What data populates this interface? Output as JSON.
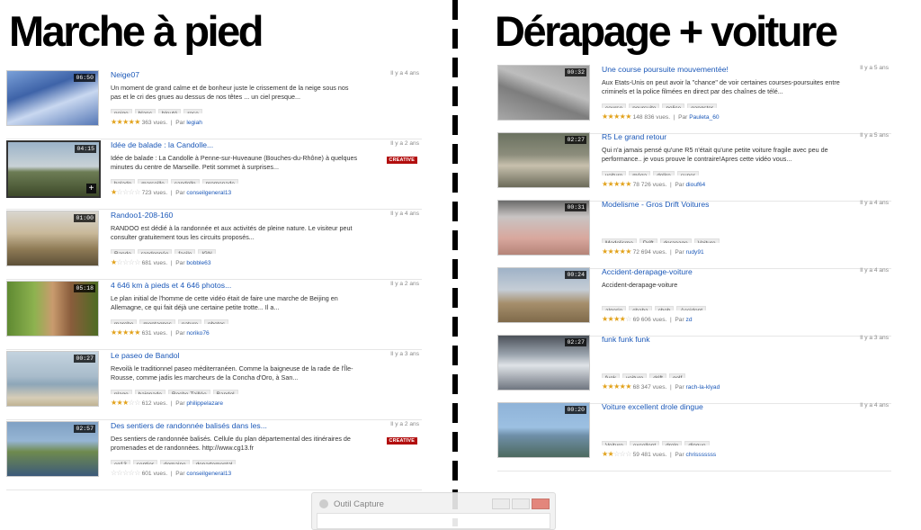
{
  "headings": {
    "left": "Marche à pied",
    "right": "Dérapage + voiture"
  },
  "colors": {
    "link": "#1b58b8",
    "star": "#e2a21b",
    "creative_badge": "#b20e0e"
  },
  "by_prefix": "Par",
  "views_suffix": "vues",
  "left_results": [
    {
      "title": "Neige07",
      "duration": "06:50",
      "age": "Il y a 4 ans",
      "description": "Un moment de grand calme et de bonheur juste le crissement de la neige sous nos pas et le cri des grues au dessus de nos têtes ... un ciel presque...",
      "tags": [
        "neige",
        "blanc",
        "bleuté",
        "rose"
      ],
      "rating": 5,
      "views": "363",
      "author": "legiah",
      "creative": false,
      "selected": false,
      "thumb_icon": "snow-scene-thumbnail"
    },
    {
      "title": "Idée de balade : la Candolle...",
      "duration": "04:15",
      "age": "Il y a 2 ans",
      "description": "Idée de balade : La Candolle à Penne-sur-Huveaune (Bouches-du-Rhône) à quelques minutes du centre de Marseille. Petit sommet à surprises...",
      "tags": [
        "balade",
        "marseille",
        "candolle",
        "promenade"
      ],
      "rating": 1,
      "views": "723",
      "author": "conseilgeneral13",
      "creative": true,
      "creative_label": "CREATIVE",
      "selected": true,
      "thumb_icon": "hillside-thumbnail"
    },
    {
      "title": "Randoo1-208-160",
      "duration": "01:00",
      "age": "Il y a 4 ans",
      "description": "RANDOO est dédié à la randonnée et aux activités de pleine nature. Le visiteur peut consulter gratuitement tous les circuits proposés...",
      "tags": [
        "Rando",
        "randonnée",
        "facile",
        "IGN"
      ],
      "rating": 1,
      "views": "681",
      "author": "bobble63",
      "creative": false,
      "selected": false,
      "thumb_icon": "hiker-thumbnail"
    },
    {
      "title": "4 646 km à pieds et 4 646 photos...",
      "duration": "05:18",
      "age": "Il y a 2 ans",
      "description": "Le plan initial de l'homme de cette vidéo était de faire une marche de Beijing en Allemagne, ce qui fait déjà une certaine petite trotte... Il a...",
      "tags": [
        "marche",
        "montagnes",
        "nature",
        "photos"
      ],
      "rating": 5,
      "views": "631",
      "author": "noriko76",
      "creative": false,
      "selected": false,
      "thumb_icon": "bearded-man-thumbnail"
    },
    {
      "title": "Le paseo de Bandol",
      "duration": "00:27",
      "age": "Il y a 3 ans",
      "description": "Revoilà le traditionnel paseo méditerranéen. Comme la baigneuse de la rade de l'Île-Rousse, comme jadis les marcheurs de la Concha d'Oro, à San...",
      "tags": [
        "plage",
        "baignade",
        "Roche-Taillée",
        "Bandol"
      ],
      "rating": 3,
      "views": "612",
      "author": "philippelazare",
      "creative": false,
      "selected": false,
      "thumb_icon": "beach-thumbnail"
    },
    {
      "title": "Des sentiers de randonnée balisés dans les...",
      "duration": "02:57",
      "age": "Il y a 2 ans",
      "description": "Des sentiers de randonnée balisés. Cellule du plan départemental des itinéraires de promenades et de randonnées. http://www.cg13.fr",
      "tags": [
        "cg13",
        "sentier",
        "domaine",
        "departemental"
      ],
      "rating": 0,
      "views": "601",
      "author": "conseilgeneral13",
      "creative": true,
      "creative_label": "CREATIVE",
      "selected": false,
      "thumb_icon": "man-interview-thumbnail"
    }
  ],
  "right_results": [
    {
      "title": "Une course poursuite mouvementée!",
      "duration": "00:32",
      "age": "Il y a 5 ans",
      "description": "Aux Etats-Unis on peut avoir la \"chance\" de voir certaines courses-poursuites entre criminels et la police filmées en direct par des chaînes de télé...",
      "tags": [
        "course",
        "poursuite",
        "police",
        "gangster"
      ],
      "rating": 5,
      "views": "148 836",
      "author": "Pauleta_60",
      "creative": false,
      "selected": false,
      "thumb_icon": "highway-thumbnail"
    },
    {
      "title": "R5 Le grand retour",
      "duration": "02:27",
      "age": "Il y a 5 ans",
      "description": "Qui n'a jamais pensé qu'une R5 n'était qu'une petite voiture fragile avec peu de performance.. je vous prouve le contraire!Apres cette vidéo vous...",
      "tags": [
        "voiture",
        "méga",
        "delire",
        "super"
      ],
      "rating": 5,
      "views": "78 726",
      "author": "diouf64",
      "creative": false,
      "selected": false,
      "thumb_icon": "forest-track-thumbnail"
    },
    {
      "title": "Modelisme - Gros Drift Voitures",
      "duration": "00:31",
      "age": "Il y a 4 ans",
      "description": "",
      "tags": [
        "Modelisme",
        "Drift",
        "derapage",
        "Voiture"
      ],
      "rating": 5,
      "views": "72 694",
      "author": "rudy91",
      "creative": false,
      "selected": false,
      "thumb_icon": "rc-car-thumbnail"
    },
    {
      "title": "Accident-derapage-voiture",
      "duration": "00:24",
      "age": "Il y a 4 ans",
      "description": "Accident-derapage-voiture",
      "tags": [
        "algerie",
        "chaba",
        "cheb",
        "Accident"
      ],
      "rating": 4,
      "views": "69 606",
      "author": "zd",
      "creative": false,
      "selected": false,
      "thumb_icon": "crash-thumbnail"
    },
    {
      "title": "funk funk funk",
      "duration": "02:27",
      "age": "Il y a 3 ans",
      "description": "",
      "tags": [
        "funk",
        "voiture",
        "drift",
        "golf"
      ],
      "rating": 5,
      "views": "68 347",
      "author": "rach-la-klyad",
      "creative": false,
      "selected": false,
      "thumb_icon": "smoke-drift-thumbnail"
    },
    {
      "title": "Voiture excellent drole dingue",
      "duration": "00:20",
      "age": "Il y a 4 ans",
      "description": "",
      "tags": [
        "Voiture",
        "excellent",
        "drole",
        "dingue"
      ],
      "rating": 2,
      "views": "59 481",
      "author": "chrisssssss",
      "creative": false,
      "selected": false,
      "thumb_icon": "lake-thumbnail"
    }
  ],
  "capture_window": {
    "title": "Outil Capture"
  }
}
